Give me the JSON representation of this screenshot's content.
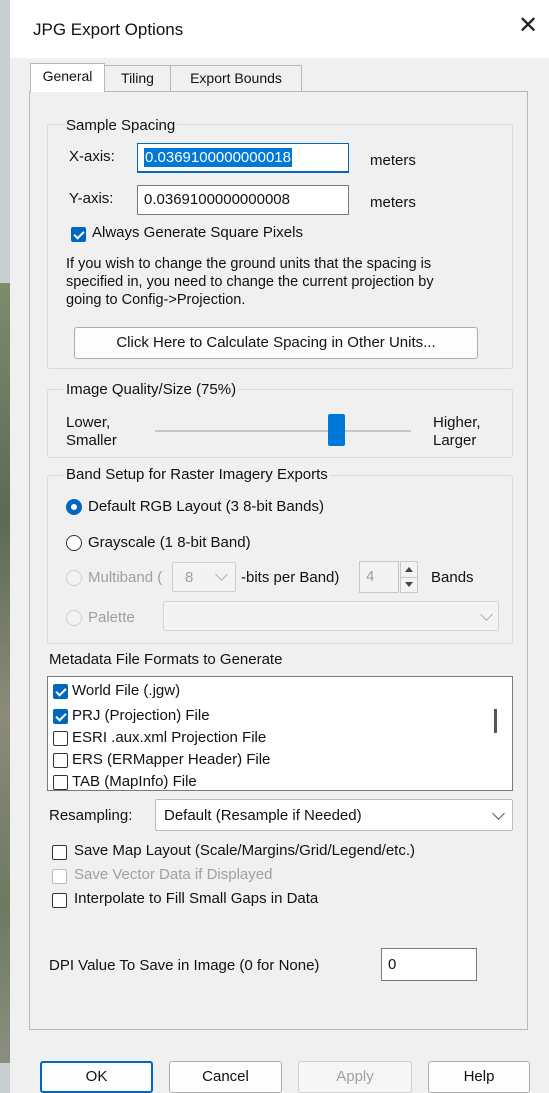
{
  "window": {
    "title": "JPG Export Options",
    "close_glyph": "✕"
  },
  "tabs": [
    {
      "label": "General"
    },
    {
      "label": "Tiling"
    },
    {
      "label": "Export Bounds"
    }
  ],
  "sample_spacing": {
    "group_label": "Sample Spacing",
    "x_label": "X-axis:",
    "x_value": "0.0369100000000018",
    "x_unit": "meters",
    "y_label": "Y-axis:",
    "y_value": "0.0369100000000008",
    "y_unit": "meters",
    "square_pixels_label": "Always Generate Square Pixels",
    "square_pixels_checked": true,
    "info_lines": [
      "If you wish to change the ground units that the spacing is",
      "specified in, you need to change the current projection by",
      "going to Config->Projection."
    ],
    "calc_button": "Click Here to Calculate Spacing in Other Units..."
  },
  "image_quality": {
    "group_label": "Image Quality/Size (75%)",
    "low_line1": "Lower,",
    "low_line2": "Smaller",
    "high_line1": "Higher,",
    "high_line2": "Larger",
    "value_percent": 75
  },
  "band_setup": {
    "group_label": "Band Setup for Raster Imagery Exports",
    "opt_default": "Default RGB Layout (3 8-bit Bands)",
    "opt_gray": "Grayscale (1 8-bit Band)",
    "opt_multi_prefix": "Multiband (",
    "multi_bits": "8",
    "opt_multi_mid": "-bits per Band)",
    "multi_bands": "4",
    "opt_multi_suffix": "Bands",
    "opt_palette": "Palette",
    "selected": "default"
  },
  "metadata": {
    "label": "Metadata File Formats to Generate",
    "items": [
      {
        "label": "World File (.jgw)",
        "checked": true
      },
      {
        "label": "PRJ (Projection) File",
        "checked": true
      },
      {
        "label": "ESRI .aux.xml Projection File",
        "checked": false
      },
      {
        "label": "ERS (ERMapper Header) File",
        "checked": false
      },
      {
        "label": "TAB (MapInfo) File",
        "checked": false
      }
    ]
  },
  "resampling": {
    "label": "Resampling:",
    "value": "Default (Resample if Needed)"
  },
  "options": {
    "save_layout": "Save Map Layout (Scale/Margins/Grid/Legend/etc.)",
    "save_vector": "Save Vector Data if Displayed",
    "interpolate": "Interpolate to Fill Small Gaps in Data"
  },
  "dpi": {
    "label": "DPI Value To Save in Image (0 for None)",
    "value": "0"
  },
  "buttons": {
    "ok": "OK",
    "cancel": "Cancel",
    "apply": "Apply",
    "help": "Help"
  },
  "colors": {
    "accent": "#0067c0",
    "selection": "#0078d7"
  }
}
